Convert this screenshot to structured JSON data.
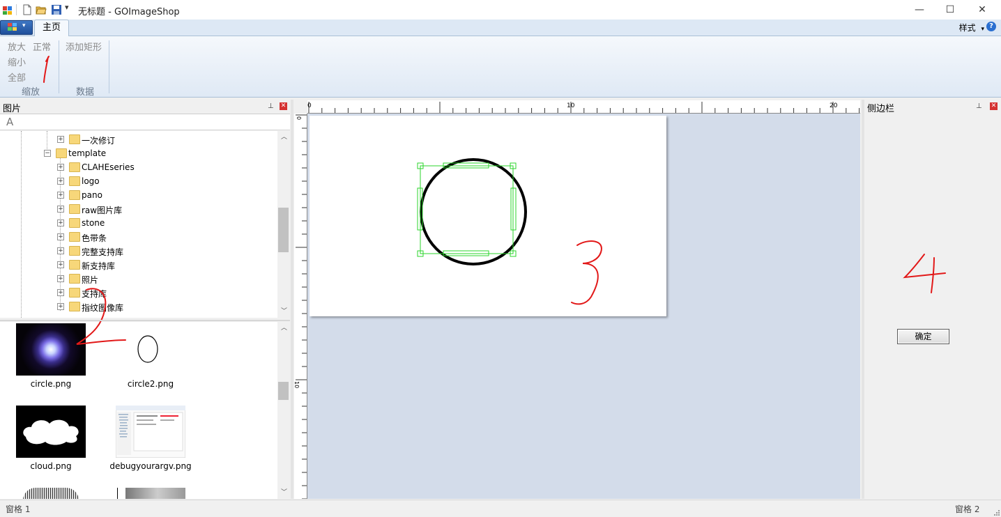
{
  "window": {
    "title": "无标题 - GOImageShop",
    "controls": {
      "minimize": "—",
      "maximize": "☐",
      "close": "✕"
    }
  },
  "ribbon": {
    "tabs": [
      {
        "label": "主页",
        "active": true
      }
    ],
    "style_menu": "样式",
    "help": "?",
    "groups": [
      {
        "label": "缩放",
        "buttons": [
          "放大",
          "正常",
          "缩小",
          "全部"
        ]
      },
      {
        "label": "数据",
        "buttons": [
          "添加矩形"
        ]
      }
    ]
  },
  "left_pane": {
    "title": "图片",
    "search_glyph": "A",
    "tree": [
      {
        "label": "一次修订",
        "level": 2
      },
      {
        "label": "template",
        "level": 1,
        "expanded": true
      },
      {
        "label": "CLAHEseries",
        "level": 2
      },
      {
        "label": "logo",
        "level": 2
      },
      {
        "label": "pano",
        "level": 2
      },
      {
        "label": "raw图片库",
        "level": 2
      },
      {
        "label": "stone",
        "level": 2
      },
      {
        "label": "色带条",
        "level": 2
      },
      {
        "label": "完整支持库",
        "level": 2
      },
      {
        "label": "新支持库",
        "level": 2
      },
      {
        "label": "照片",
        "level": 2
      },
      {
        "label": "支持库",
        "level": 2
      },
      {
        "label": "指纹图像库",
        "level": 2
      }
    ],
    "thumbnails": [
      {
        "name": "circle.png",
        "icon": "glowing-circle-image"
      },
      {
        "name": "circle2.png",
        "icon": "ellipse-outline-image"
      },
      {
        "name": "cloud.png",
        "icon": "cloud-image"
      },
      {
        "name": "debugyourargv.png",
        "icon": "screenshot-image"
      }
    ]
  },
  "canvas": {
    "ruler_labels": [
      "0",
      "10",
      "20"
    ],
    "vruler_labels": [
      "0",
      "10"
    ],
    "annotation_3": "3"
  },
  "right_pane": {
    "title": "侧边栏",
    "ok_button": "确定",
    "annotation_4": "4"
  },
  "annotations": {
    "mark_1": "1",
    "mark_2": "2"
  },
  "statusbar": {
    "left": "窗格 1",
    "right": "窗格 2"
  }
}
